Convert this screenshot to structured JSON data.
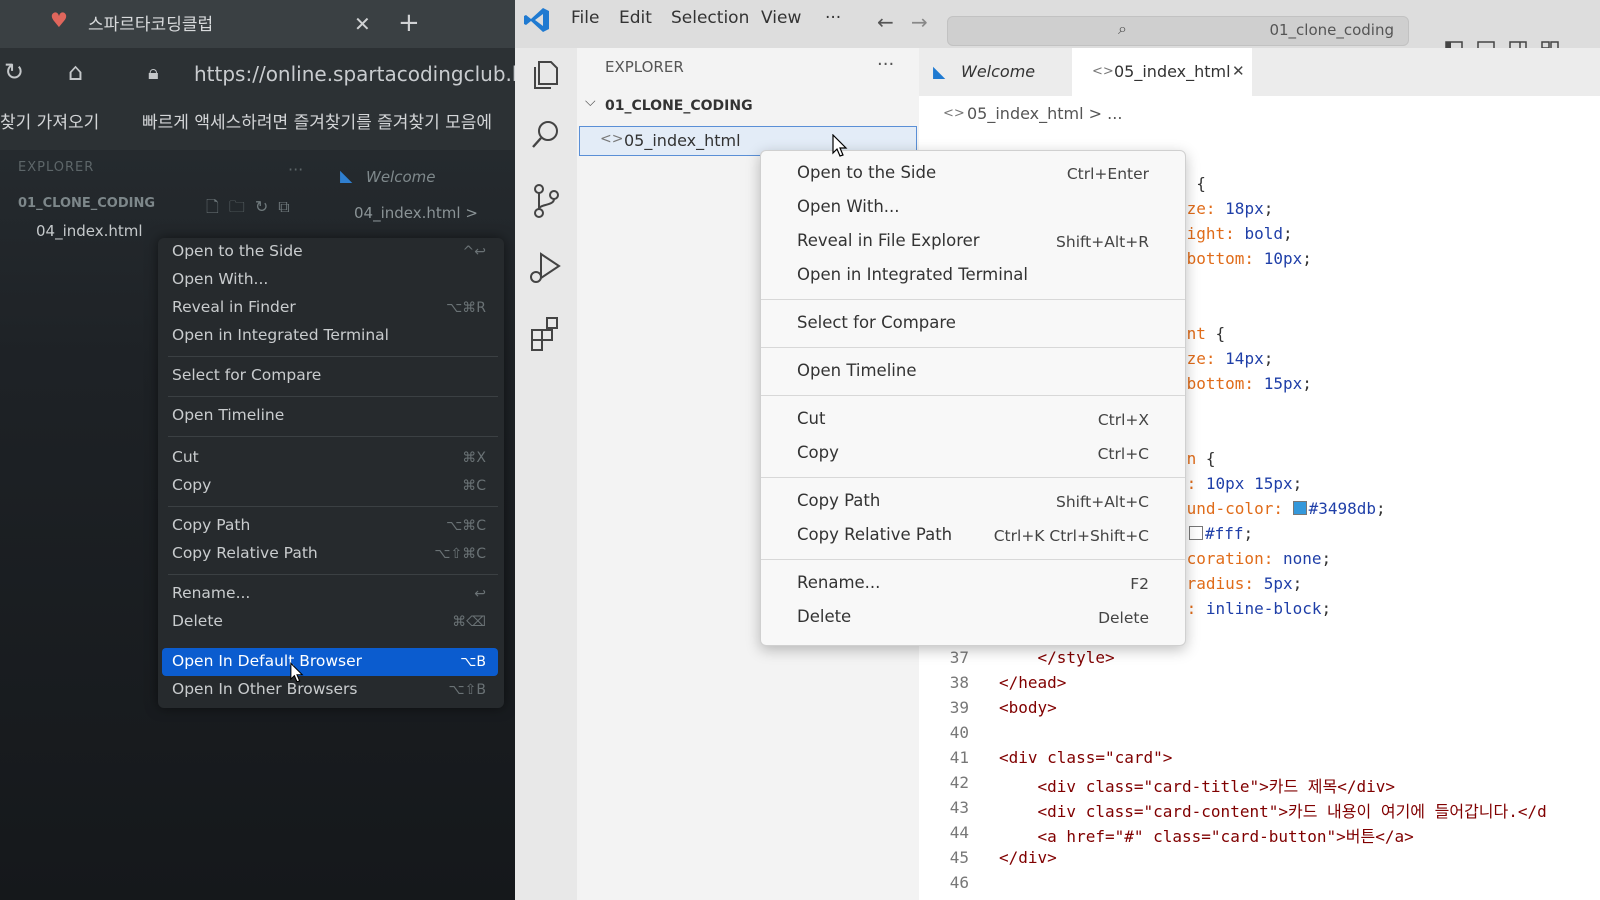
{
  "left_browser": {
    "tab_title": "스파르타코딩클럽",
    "url": "https://online.spartacodingclub.kr/er",
    "fav_import": "찾기 가져오기",
    "fav_hint": "빠르게 액세스하려면 즐겨찾기를 즐겨찾기 모음에",
    "explorer_label": "EXPLORER",
    "project": "01_CLONE_CODING",
    "file": "04_index.html",
    "welcome_tab": "Welcome",
    "breadcrumb": "04_index.html >",
    "menu": [
      {
        "label": "Open to the Side",
        "shortcut": "^↩"
      },
      {
        "label": "Open With...",
        "shortcut": ""
      },
      {
        "label": "Reveal in Finder",
        "shortcut": "⌥⌘R"
      },
      {
        "label": "Open in Integrated Terminal",
        "shortcut": ""
      },
      {
        "label": "Select for Compare",
        "shortcut": ""
      },
      {
        "label": "Open Timeline",
        "shortcut": ""
      },
      {
        "label": "Cut",
        "shortcut": "⌘X"
      },
      {
        "label": "Copy",
        "shortcut": "⌘C"
      },
      {
        "label": "Copy Path",
        "shortcut": "⌥⌘C"
      },
      {
        "label": "Copy Relative Path",
        "shortcut": "⌥⇧⌘C"
      },
      {
        "label": "Rename...",
        "shortcut": "↩"
      },
      {
        "label": "Delete",
        "shortcut": "⌘⌫"
      },
      {
        "label": "Open In Default Browser",
        "shortcut": "⌥B"
      },
      {
        "label": "Open In Other Browsers",
        "shortcut": "⌥⇧B"
      }
    ]
  },
  "vscode": {
    "menubar": [
      "File",
      "Edit",
      "Selection",
      "View",
      "···"
    ],
    "search_placeholder": "01_clone_coding",
    "explorer_label": "EXPLORER",
    "explorer_more": "···",
    "project": "01_CLONE_CODING",
    "selected_file": "05_index_html",
    "tabs": [
      {
        "label": "Welcome"
      },
      {
        "label": "05_index_html",
        "close": "✕"
      }
    ],
    "breadcrumb": "05_index_html > ...",
    "accent": "#007acc",
    "css_fragments": [
      [
        "e ",
        "{",
        ""
      ],
      [
        "ize: ",
        "18px",
        ";"
      ],
      [
        "eight: ",
        "bold",
        ";"
      ],
      [
        "-bottom: ",
        "10px",
        ";"
      ],
      [
        "ent ",
        "{",
        ""
      ],
      [
        "ize: ",
        "14px",
        ";"
      ],
      [
        "-bottom: ",
        "15px",
        ";"
      ],
      [
        "on ",
        "{",
        ""
      ],
      [
        "g: ",
        "10px 15px",
        ";"
      ],
      [
        "ound-color: ",
        "#3498db",
        ";"
      ],
      [
        "",
        "#fff",
        ";"
      ],
      [
        "ecoration: ",
        "none",
        ";"
      ],
      [
        "-radius: ",
        "5px",
        ";"
      ],
      [
        "y: ",
        "inline-block",
        ";"
      ]
    ],
    "code_lines": [
      {
        "n": "37",
        "text": "    </style>"
      },
      {
        "n": "38",
        "text": "</head>"
      },
      {
        "n": "39",
        "text": "<body>"
      },
      {
        "n": "40",
        "text": ""
      },
      {
        "n": "41",
        "text": "<div class=\"card\">"
      },
      {
        "n": "42",
        "text": "    <div class=\"card-title\">카드 제목</div>"
      },
      {
        "n": "43",
        "text": "    <div class=\"card-content\">카드 내용이 여기에 들어갑니다.</d"
      },
      {
        "n": "44",
        "text": "    <a href=\"#\" class=\"card-button\">버튼</a>"
      },
      {
        "n": "45",
        "text": "</div>"
      },
      {
        "n": "46",
        "text": ""
      }
    ],
    "context_menu": [
      {
        "label": "Open to the Side",
        "shortcut": "Ctrl+Enter"
      },
      {
        "label": "Open With...",
        "shortcut": ""
      },
      {
        "label": "Reveal in File Explorer",
        "shortcut": "Shift+Alt+R"
      },
      {
        "label": "Open in Integrated Terminal",
        "shortcut": ""
      },
      {
        "label": "Select for Compare",
        "shortcut": ""
      },
      {
        "label": "Open Timeline",
        "shortcut": ""
      },
      {
        "label": "Cut",
        "shortcut": "Ctrl+X"
      },
      {
        "label": "Copy",
        "shortcut": "Ctrl+C"
      },
      {
        "label": "Copy Path",
        "shortcut": "Shift+Alt+C"
      },
      {
        "label": "Copy Relative Path",
        "shortcut": "Ctrl+K Ctrl+Shift+C"
      },
      {
        "label": "Rename...",
        "shortcut": "F2"
      },
      {
        "label": "Delete",
        "shortcut": "Delete"
      }
    ]
  }
}
